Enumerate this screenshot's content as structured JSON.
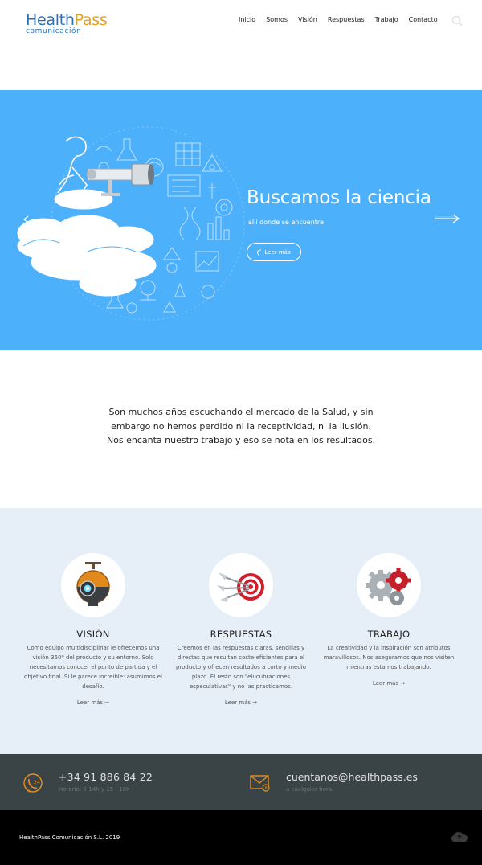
{
  "header": {
    "logo": {
      "part1": "Health",
      "part2": "Pass",
      "tagline": "comunicación"
    },
    "nav": [
      "Inicio",
      "Somos",
      "Visión",
      "Respuestas",
      "Trabajo",
      "Contacto"
    ]
  },
  "hero": {
    "title": "Buscamos la ciencia",
    "subtitle": "allí donde se encuentre",
    "button_label": "Leer más",
    "background_color": "#4db0fb"
  },
  "intro": {
    "text": "Son muchos años escuchando el mercado de la Salud, y sin embargo no hemos perdido ni la receptividad, ni la ilusión. Nos encanta nuestro trabajo y eso se nota en los resultados."
  },
  "features": [
    {
      "title": "VISIÓN",
      "description": "Como equipo multidisciplinar le ofrecemos una visión 360º del producto y su entorno. Solo necesitamos conocer el punto de partida y el objetivo final. Si le parece increíble: asumimos el desafío.",
      "link": "Leer más  →",
      "icon": "robot-eye-icon"
    },
    {
      "title": "RESPUESTAS",
      "description": "Creemos en las respuestas claras, sencillas y directas que resultan coste-eficientes para el producto y ofrecen resultados a corto y medio plazo. El resto son \"elucubraciones especulativas\" y no las practicamos.",
      "link": "Leer más  →",
      "icon": "darts-target-icon"
    },
    {
      "title": "TRABAJO",
      "description": "La creatividad y la inspiración son atributos maravillosos. Nos aseguramos que nos visiten mientras estamos trabajando.",
      "link": "Leer más  →",
      "icon": "gears-icon"
    }
  ],
  "contact": {
    "phone": "+34 91 886 84 22",
    "hours": "Horario: 9-14h y 15 - 18h",
    "email": "cuentanos@healthpass.es",
    "email_note": "a cualquier hora"
  },
  "footer": {
    "copyright": "HealthPass Comunicación S.L. 2019"
  }
}
